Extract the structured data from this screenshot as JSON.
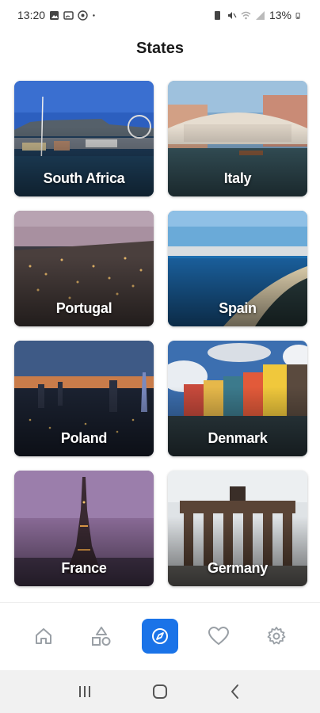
{
  "status_bar": {
    "time": "13:20",
    "battery": "13%",
    "left_icons": [
      "image-icon",
      "cast-icon",
      "settings-circle-icon"
    ],
    "right_icons": [
      "alarm-icon",
      "mute-icon",
      "wifi-icon",
      "signal-icon",
      "battery-icon"
    ]
  },
  "header": {
    "title": "States"
  },
  "states": [
    {
      "name": "South Africa"
    },
    {
      "name": "Italy"
    },
    {
      "name": "Portugal"
    },
    {
      "name": "Spain"
    },
    {
      "name": "Poland"
    },
    {
      "name": "Denmark"
    },
    {
      "name": "France"
    },
    {
      "name": "Germany"
    }
  ],
  "bottom_nav": {
    "items": [
      {
        "icon": "home-icon",
        "active": false
      },
      {
        "icon": "shapes-icon",
        "active": false
      },
      {
        "icon": "compass-icon",
        "active": true
      },
      {
        "icon": "heart-icon",
        "active": false
      },
      {
        "icon": "settings-icon",
        "active": false
      }
    ],
    "accent_color": "#1a73e8"
  },
  "system_nav": {
    "items": [
      "recent-apps-icon",
      "home-button-icon",
      "back-icon"
    ]
  }
}
